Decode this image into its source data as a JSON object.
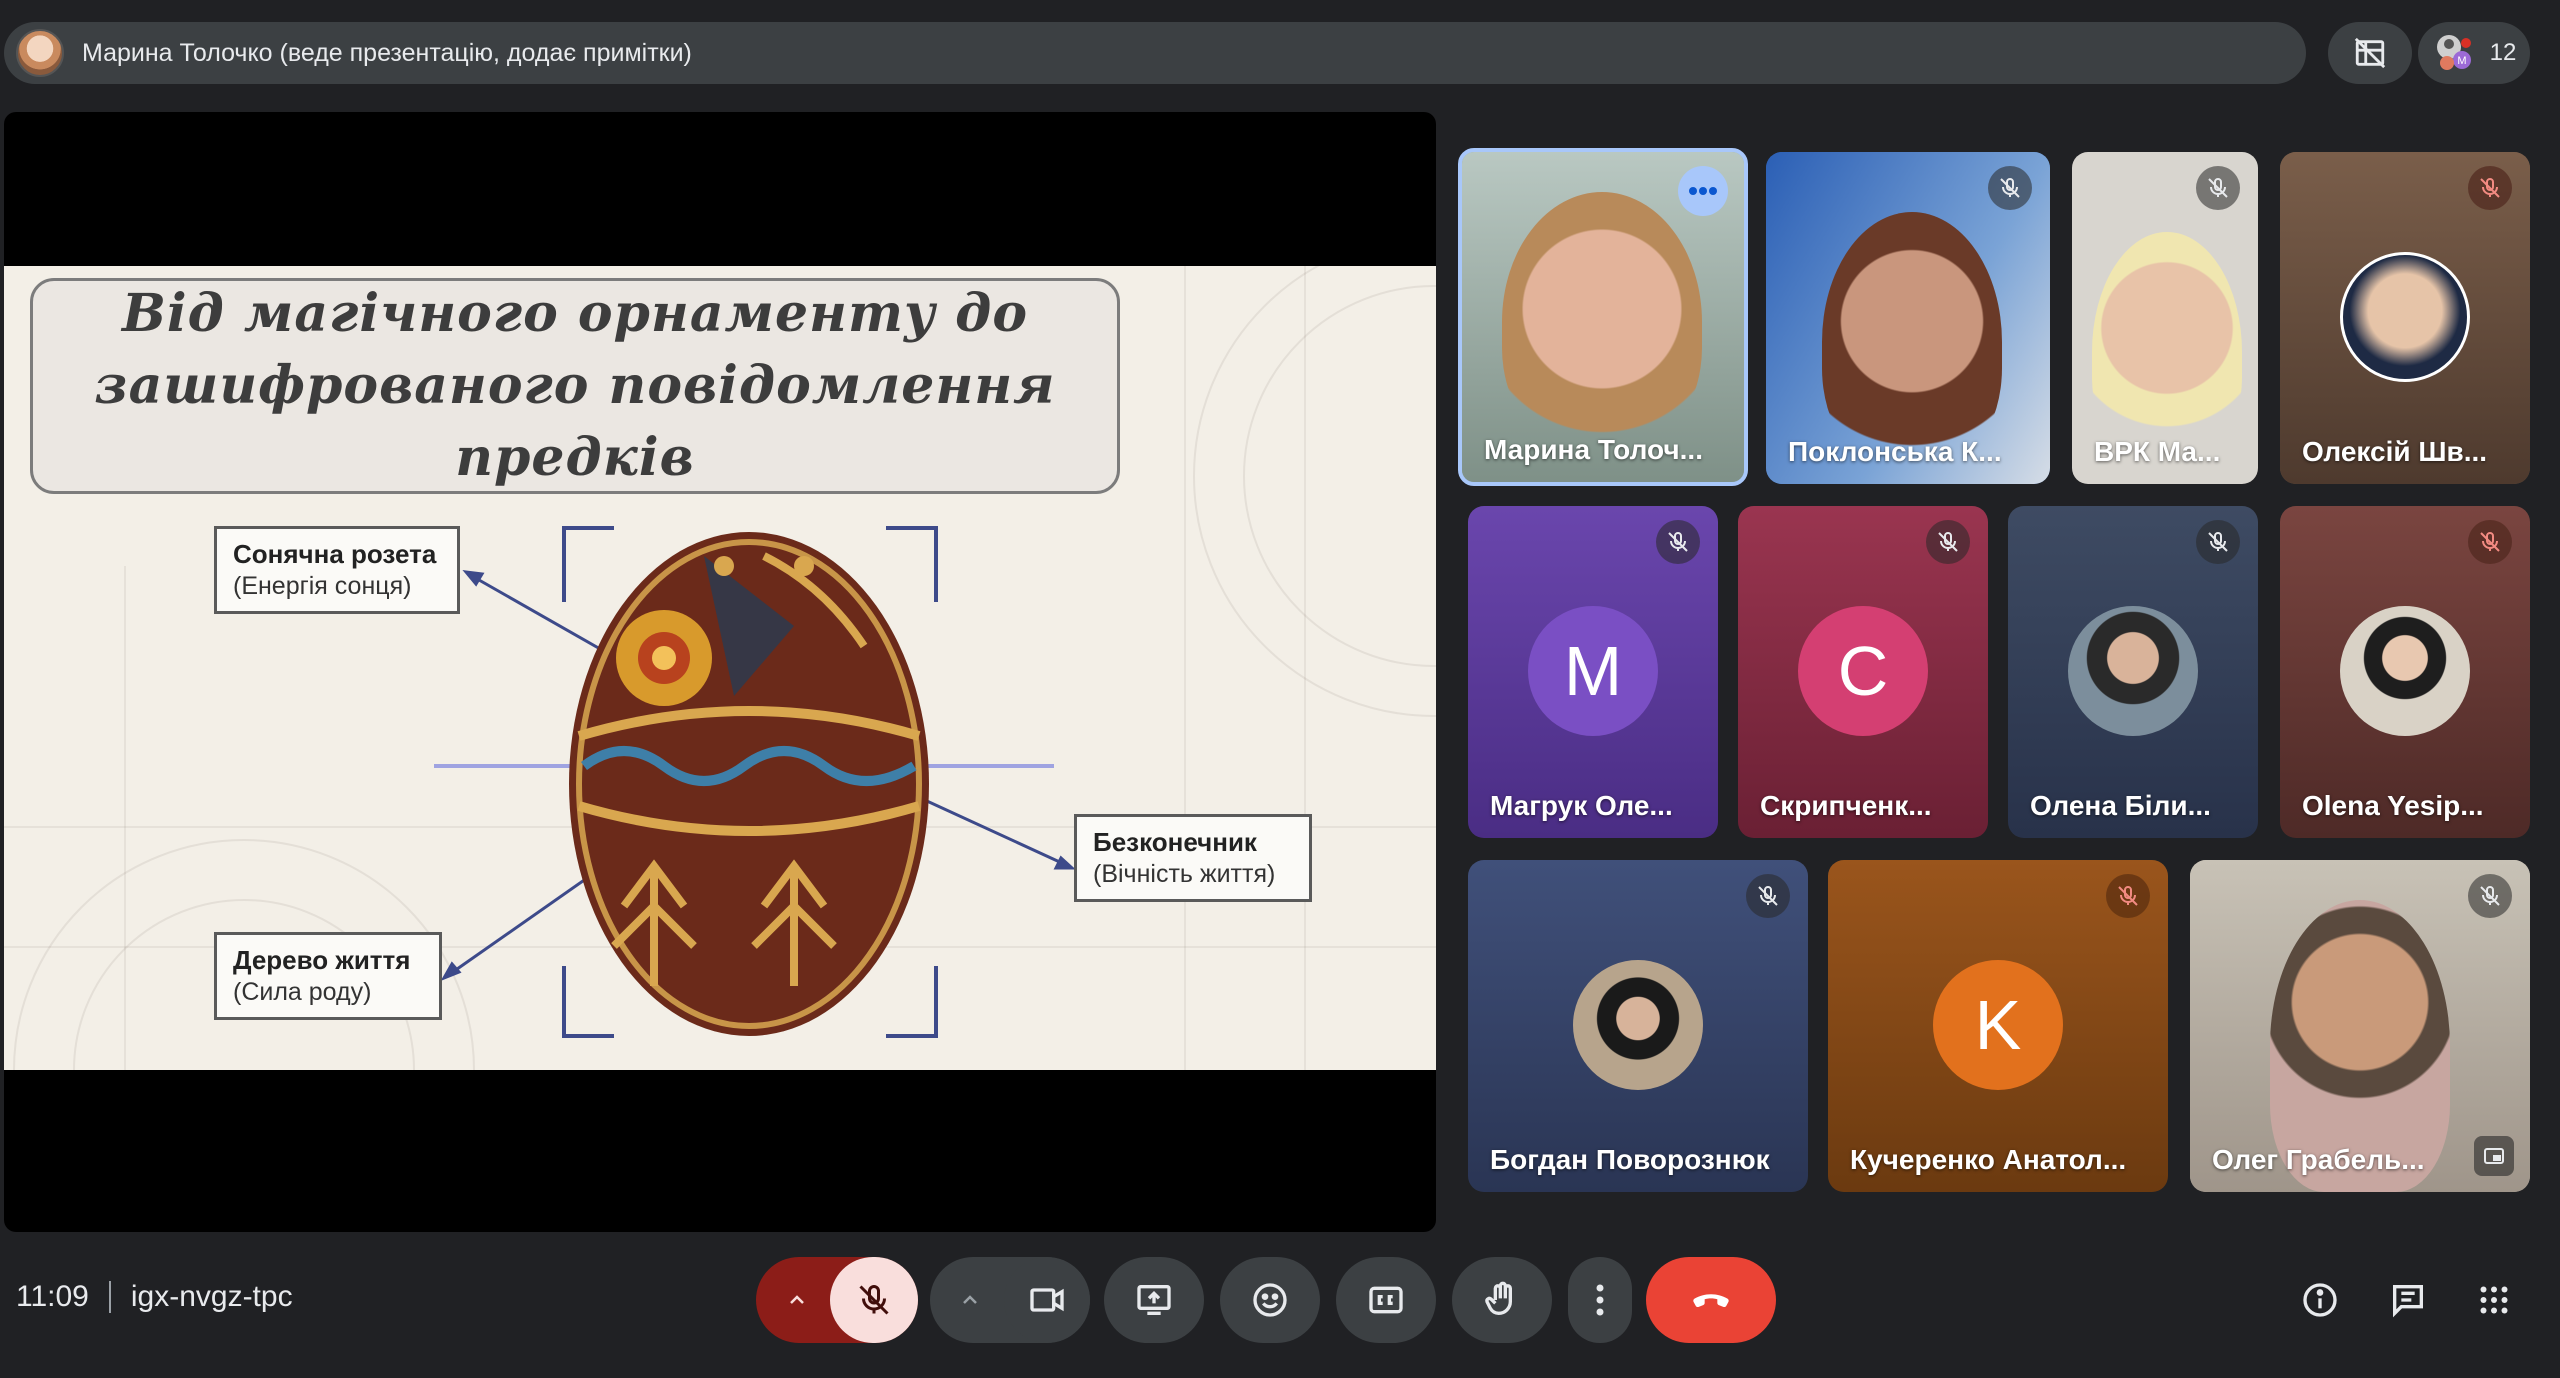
{
  "top_bar": {
    "presenter_text": "Марина Толочко (веде презентацію, додає примітки)",
    "people_count": "12"
  },
  "slide": {
    "title_line1": "Від магічного орнаменту до",
    "title_line2": "зашифрованого повідомлення предків",
    "labels": [
      {
        "title": "Сонячна розета",
        "sub": "(Енергія сонця)"
      },
      {
        "title": "Безконечник",
        "sub": "(Вічність життя)"
      },
      {
        "title": "Дерево життя",
        "sub": "(Сила роду)"
      }
    ]
  },
  "participants": [
    {
      "name": "Марина Толоч...",
      "color": "#8fa7a0",
      "icon": "more-options-icon"
    },
    {
      "name": "Поклонська К...",
      "color": "#2f64b8",
      "icon": "mic-off-icon"
    },
    {
      "name": "ВРК Ма...",
      "color": "#d8d5cf",
      "icon": "mic-off-icon"
    },
    {
      "name": "Олексій Шв...",
      "color": "#6a5140",
      "icon": "mic-off-icon"
    },
    {
      "name": "Магрук Оле...",
      "color": "#5e3ea0",
      "avatar_letter": "M",
      "avatar_color": "#7a4fc4",
      "icon": "mic-off-icon"
    },
    {
      "name": "Скрипченк...",
      "color": "#8a2f44",
      "avatar_letter": "С",
      "avatar_color": "#d43f72",
      "icon": "mic-off-icon"
    },
    {
      "name": "Олена Біли...",
      "color": "#364257",
      "icon": "mic-off-icon"
    },
    {
      "name": "Olena Yesip...",
      "color": "#6a3a36",
      "icon": "mic-off-icon"
    },
    {
      "name": "Богдан Поворознюк",
      "color": "#3a4a6e",
      "icon": "mic-off-icon"
    },
    {
      "name": "Кучеренко Анатол...",
      "color": "#8b4a16",
      "avatar_letter": "K",
      "avatar_color": "#e2711d",
      "icon": "mic-off-icon"
    },
    {
      "name": "Олег Грабель...",
      "color": "#b9b0a2",
      "icon": "mic-off-icon"
    }
  ],
  "bottom_bar": {
    "time": "11:09",
    "meeting_code": "igx-nvgz-tpc"
  },
  "colors": {
    "end_call": "#ea4335",
    "mic_muted_bg": "#f9dedc",
    "mic_muted_group": "#8c1d18",
    "bar_bg": "#3c4043"
  }
}
